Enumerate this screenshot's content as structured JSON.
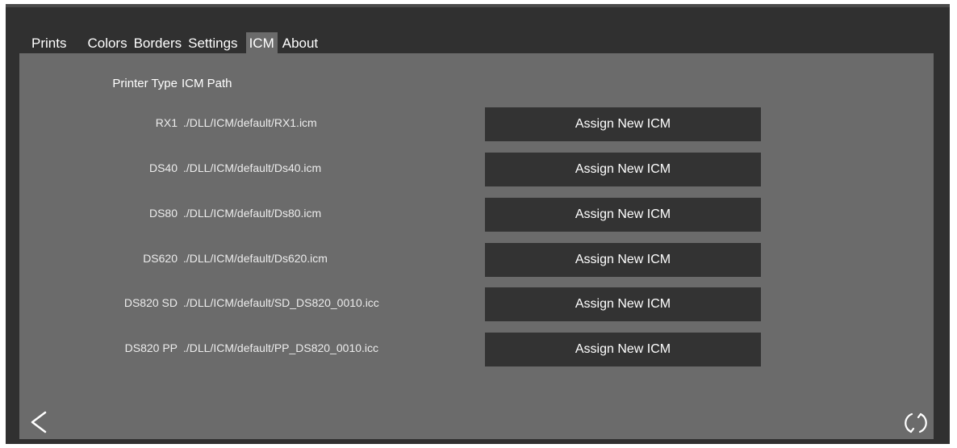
{
  "tabs": [
    {
      "label": "Prints",
      "active": false
    },
    {
      "label": "Colors",
      "active": false
    },
    {
      "label": "Borders",
      "active": false
    },
    {
      "label": "Settings",
      "active": false
    },
    {
      "label": "ICM",
      "active": true
    },
    {
      "label": "About",
      "active": false
    }
  ],
  "header": {
    "printer_type": "Printer Type",
    "icm_path": "ICM Path"
  },
  "rows": [
    {
      "printer": "RX1",
      "path": "./DLL/ICM/default/RX1.icm",
      "button": "Assign New ICM"
    },
    {
      "printer": "DS40",
      "path": "./DLL/ICM/default/Ds40.icm",
      "button": "Assign New ICM"
    },
    {
      "printer": "DS80",
      "path": "./DLL/ICM/default/Ds80.icm",
      "button": "Assign New ICM"
    },
    {
      "printer": "DS620",
      "path": "./DLL/ICM/default/Ds620.icm",
      "button": "Assign New ICM"
    },
    {
      "printer": "DS820 SD",
      "path": "./DLL/ICM/default/SD_DS820_0010.icc",
      "button": "Assign New ICM"
    },
    {
      "printer": "DS820 PP",
      "path": "./DLL/ICM/default/PP_DS820_0010.icc",
      "button": "Assign New ICM"
    }
  ],
  "icons": {
    "back": "back-arrow-icon",
    "refresh": "refresh-icon"
  },
  "colors": {
    "frame_bg": "#303030",
    "panel_bg": "#6b6b6b",
    "button_bg": "#333333",
    "text": "#ffffff"
  }
}
